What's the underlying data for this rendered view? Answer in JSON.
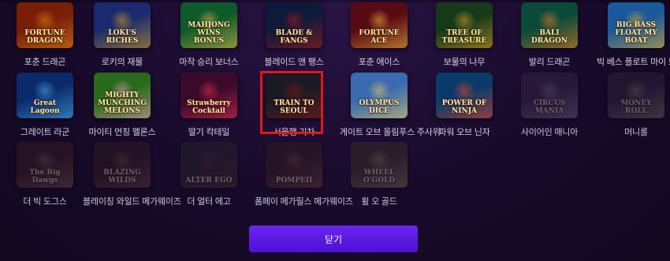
{
  "games": [
    {
      "label": "포춘 드래곤",
      "art": "FORTUNE DRAGON",
      "colors": [
        "#7a1e08",
        "#e08a18"
      ],
      "dim": false
    },
    {
      "label": "로키의 재물",
      "art": "LOKI'S RICHES",
      "colors": [
        "#1b2a6e",
        "#d4a01e"
      ],
      "dim": false
    },
    {
      "label": "마작 승리 보너스",
      "art": "MAHJONG WINS BONUS",
      "colors": [
        "#0f5a2a",
        "#e4c04a"
      ],
      "dim": false
    },
    {
      "label": "블레이드 앤 팽스",
      "art": "BLADE & FANGS",
      "colors": [
        "#0e1a3a",
        "#b01818"
      ],
      "dim": false
    },
    {
      "label": "포춘 에이스",
      "art": "FORTUNE ACE",
      "colors": [
        "#5a0a12",
        "#f0c040"
      ],
      "dim": false
    },
    {
      "label": "보물의 나무",
      "art": "TREE OF TREASURE",
      "colors": [
        "#143a1a",
        "#e0a020"
      ],
      "dim": false
    },
    {
      "label": "발리 드래곤",
      "art": "BALI DRAGON",
      "colors": [
        "#0a4a3a",
        "#f08020"
      ],
      "dim": false
    },
    {
      "label": "빅 베스 플로트 마이 보트",
      "art": "BIG BASS FLOAT MY BOAT",
      "colors": [
        "#1a5a9a",
        "#f0b020"
      ],
      "dim": false
    },
    {
      "label": "그레이트 라군",
      "art": "Great Lagoon",
      "colors": [
        "#0a2a6a",
        "#4ab0f0"
      ],
      "dim": false
    },
    {
      "label": "마이티 먼칭 멜론스",
      "art": "MIGHTY MUNCHING MELONS",
      "colors": [
        "#2a6a1a",
        "#f0a0c0"
      ],
      "dim": false
    },
    {
      "label": "딸기 칵테일",
      "art": "Strawberry Cocktail",
      "colors": [
        "#3a0a2a",
        "#f03050"
      ],
      "dim": false
    },
    {
      "label": "서울행 기차",
      "art": "TRAIN TO SEOUL",
      "colors": [
        "#1a1a24",
        "#8a1a1a"
      ],
      "dim": false
    },
    {
      "label": "게이트 오브 올림푸스 주사위",
      "art": "OLYMPUS DICE",
      "colors": [
        "#3a6ab0",
        "#f0d060"
      ],
      "dim": false
    },
    {
      "label": "파워 오브 닌자",
      "art": "POWER OF NINJA",
      "colors": [
        "#0a3a6a",
        "#f04020"
      ],
      "dim": false
    },
    {
      "label": "사이어인 매니아",
      "art": "CIRCUS MANIA",
      "colors": [
        "#4a2a6a",
        "#c0a0e0"
      ],
      "dim": true
    },
    {
      "label": "머니롤",
      "art": "MONEY ROLL",
      "colors": [
        "#3a2a5a",
        "#d0b060"
      ],
      "dim": true
    },
    {
      "label": "더 빅 도그스",
      "art": "The Big Dawgs",
      "colors": [
        "#5a1a1a",
        "#d08040"
      ],
      "dim": true
    },
    {
      "label": "블레이징 와일드 메가웨이즈",
      "art": "BLAZING WILDS",
      "colors": [
        "#4a1a1a",
        "#d06020"
      ],
      "dim": true
    },
    {
      "label": "더 얼터 에고",
      "art": "ALTER EGO",
      "colors": [
        "#2a2a2a",
        "#a03030"
      ],
      "dim": true
    },
    {
      "label": "폼페이 메가릴스 메가웨이즈",
      "art": "POMPEII",
      "colors": [
        "#4a1a0a",
        "#e06020"
      ],
      "dim": true
    },
    {
      "label": "휠 오 골드",
      "art": "WHEEL O'GOLD",
      "colors": [
        "#4a3a0a",
        "#e0b040"
      ],
      "dim": true
    }
  ],
  "close_button": {
    "label": "닫기"
  },
  "colors": {
    "accent": "#5a17e0",
    "highlight": "#e01818",
    "background": "#170a2a"
  }
}
